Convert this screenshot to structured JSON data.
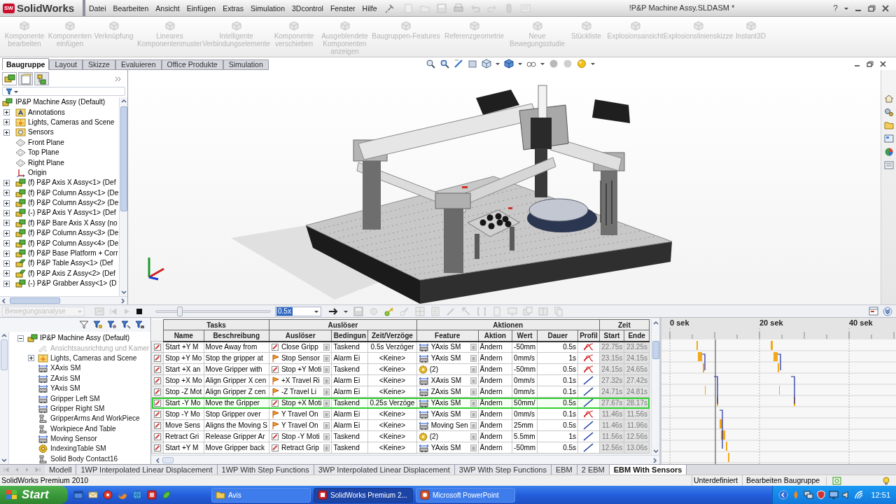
{
  "app_bar": {
    "logo_badge": "SW",
    "logo_name": "SolidWorks",
    "menus": [
      "Datei",
      "Bearbeiten",
      "Ansicht",
      "Einfügen",
      "Extras",
      "Simulation",
      "3Dcontrol",
      "Fenster",
      "Hilfe"
    ],
    "document_title": "!P&P Machine Assy.SLDASM *",
    "help": "?"
  },
  "command_manager": [
    {
      "label": "Komponente bearbeiten",
      "disabled": true
    },
    {
      "label": "Komponenten einfügen",
      "disabled": true
    },
    {
      "label": "Verknüpfung",
      "disabled": true
    },
    {
      "label": "Lineares Komponentenmuster",
      "disabled": true
    },
    {
      "label": "Intelligente Verbindungselemente",
      "disabled": true
    },
    {
      "label": "Komponente verschieben",
      "disabled": true
    },
    {
      "label": "Ausgeblendete Komponenten anzeigen",
      "disabled": true
    },
    {
      "label": "Baugruppen-Features",
      "disabled": true
    },
    {
      "label": "Referenzgeometrie",
      "disabled": true
    },
    {
      "label": "Neue Bewegungsstudie",
      "disabled": true
    },
    {
      "label": "Stückliste",
      "disabled": true
    },
    {
      "label": "Explosionsansicht",
      "disabled": true
    },
    {
      "label": "Explosionslinienskizze",
      "disabled": true
    },
    {
      "label": "Instant3D",
      "disabled": true
    }
  ],
  "command_tabs": [
    {
      "label": "Baugruppe",
      "selected": true
    },
    {
      "label": "Layout",
      "selected": false
    },
    {
      "label": "Skizze",
      "selected": false
    },
    {
      "label": "Evaluieren",
      "selected": false
    },
    {
      "label": "Office Produkte",
      "selected": false
    },
    {
      "label": "Simulation",
      "selected": false
    }
  ],
  "feature_tree": {
    "root": {
      "label": "IP&P Machine Assy  (Default)",
      "kind": "assembly",
      "children": [
        {
          "label": "Annotations",
          "kind": "annotations",
          "expanded": false
        },
        {
          "label": "Lights, Cameras and Scene",
          "kind": "lights",
          "expanded": false
        },
        {
          "label": "Sensors",
          "kind": "sensors",
          "expanded": false
        },
        {
          "label": "Front Plane",
          "kind": "plane"
        },
        {
          "label": "Top Plane",
          "kind": "plane"
        },
        {
          "label": "Right Plane",
          "kind": "plane"
        },
        {
          "label": "Origin",
          "kind": "origin"
        },
        {
          "label": "(f) P&P Axis X Assy<1> (Def",
          "kind": "assembly",
          "expanded": false
        },
        {
          "label": "(f) P&P Column Assy<1> (De",
          "kind": "assembly",
          "expanded": false
        },
        {
          "label": "(f) P&P Column Assy<2> (De",
          "kind": "assembly",
          "expanded": false
        },
        {
          "label": "(-) P&P Axis Y Assy<1> (Def",
          "kind": "assembly",
          "expanded": false
        },
        {
          "label": "(f) P&P Bare Axis X Assy (no",
          "kind": "assembly",
          "expanded": false
        },
        {
          "label": "(f) P&P Column Assy<3> (De",
          "kind": "assembly",
          "expanded": false
        },
        {
          "label": "(f) P&P Column Assy<4> (De",
          "kind": "assembly",
          "expanded": false
        },
        {
          "label": "(f) P&P Base Platform + Corr",
          "kind": "assembly",
          "expanded": false
        },
        {
          "label": "(f) P&P Table Assy<1> (Def",
          "kind": "flexible_assembly",
          "expanded": false
        },
        {
          "label": "(f) P&P Axis Z Assy<2> (Def",
          "kind": "flexible_assembly",
          "expanded": false
        },
        {
          "label": "(-) P&P Grabber Assy<1> (D",
          "kind": "assembly",
          "expanded": false
        }
      ]
    }
  },
  "motion_toolbar": {
    "study_type": {
      "label": "Bewegungsanalyse",
      "disabled": true
    },
    "time_slider": {
      "level": 0.2
    },
    "speed": "0.5x"
  },
  "motion_tree": {
    "root": {
      "label": "IP&P Machine Assy  (Default)",
      "kind": "assembly",
      "expanded": true,
      "children": [
        {
          "label": "Ansichtsausrichtung und Kamer",
          "kind": "view",
          "disabled": true
        },
        {
          "label": "Lights, Cameras and Scene",
          "kind": "lights",
          "expanded": false,
          "disabled": false
        },
        {
          "label": "XAxis SM",
          "kind": "motor",
          "disabled": false
        },
        {
          "label": "ZAxis SM",
          "kind": "motor",
          "disabled": false
        },
        {
          "label": "YAxis SM",
          "kind": "motor",
          "disabled": false
        },
        {
          "label": "Gripper Left SM",
          "kind": "motor",
          "disabled": false
        },
        {
          "label": "Gripper Right SM",
          "kind": "motor",
          "disabled": false
        },
        {
          "label": "GripperArms And WorkPiece",
          "kind": "contact",
          "disabled": false
        },
        {
          "label": "Workpiece And Table",
          "kind": "contact",
          "disabled": false
        },
        {
          "label": "Moving Sensor",
          "kind": "motor",
          "disabled": false
        },
        {
          "label": "IndexingTable SM",
          "kind": "rotary_motor",
          "disabled": false
        },
        {
          "label": "Solid Body Contact16",
          "kind": "contact",
          "disabled": false
        }
      ]
    }
  },
  "table": {
    "groups": [
      "Tasks",
      "Auslöser",
      "Aktionen",
      "Zeit"
    ],
    "columns": [
      "Name",
      "Beschreibung",
      "Auslöser",
      "Bedingun",
      "Zeit/Verzöge",
      "Feature",
      "Aktion",
      "Wert",
      "Dauer",
      "Profil",
      "Start",
      "Ende"
    ],
    "rows": [
      {
        "name": "Start +Y M",
        "description": "Move Away from",
        "trigger": {
          "label": "Close Gripp",
          "kind": "task"
        },
        "condition": "Taskend",
        "delay": "0.5s Verzöger",
        "feature": {
          "label": "YAxis SM",
          "kind": "motor"
        },
        "action": "Ändern",
        "value": "-50mm",
        "duration": "0.5s",
        "profile": {
          "kind": "curve"
        },
        "start": "22.75s",
        "end": "23.25s",
        "selected": false
      },
      {
        "name": "Stop +Y Mo",
        "description": "Stop the gripper at",
        "trigger": {
          "label": "Stop Sensor",
          "kind": "sensor"
        },
        "condition": "Alarm Ei",
        "delay": "<Keine>",
        "feature": {
          "label": "YAxis SM",
          "kind": "motor"
        },
        "action": "Ändern",
        "value": "0mm/s",
        "duration": "1s",
        "profile": {
          "kind": "curve"
        },
        "start": "23.15s",
        "end": "24.15s",
        "selected": false
      },
      {
        "name": "Start +X an",
        "description": "Move Gripper with",
        "trigger": {
          "label": "Stop +Y Moti",
          "kind": "task"
        },
        "condition": "Taskend",
        "delay": "<Keine>",
        "feature": {
          "label": "(2)",
          "kind": "group"
        },
        "action": "Ändern",
        "value": "-50mm",
        "duration": "0.5s",
        "profile": {
          "kind": "curve"
        },
        "start": "24.15s",
        "end": "24.65s",
        "selected": false
      },
      {
        "name": "Stop +X Mo",
        "description": "Align Gripper X cen",
        "trigger": {
          "label": "+X Travel Ri",
          "kind": "sensor"
        },
        "condition": "Alarm Ei",
        "delay": "<Keine>",
        "feature": {
          "label": "XAxis SM",
          "kind": "motor"
        },
        "action": "Ändern",
        "value": "0mm/s",
        "duration": "0.1s",
        "profile": {
          "kind": "linear"
        },
        "start": "27.32s",
        "end": "27.42s",
        "selected": false
      },
      {
        "name": "Stop -Z Mot",
        "description": "Align Gripper Z cen",
        "trigger": {
          "label": "-Z Travel Li",
          "kind": "sensor"
        },
        "condition": "Alarm Ei",
        "delay": "<Keine>",
        "feature": {
          "label": "ZAxis SM",
          "kind": "motor"
        },
        "action": "Ändern",
        "value": "0mm/s",
        "duration": "0.1s",
        "profile": {
          "kind": "linear"
        },
        "start": "24.71s",
        "end": "24.81s",
        "selected": false
      },
      {
        "name": "Start -Y Mo",
        "description": "Move the Gripper",
        "trigger": {
          "label": "Stop +X Moti",
          "kind": "task"
        },
        "condition": "Taskend",
        "delay": "0.25s Verzöge",
        "feature": {
          "label": "YAxis SM",
          "kind": "motor"
        },
        "action": "Ändern",
        "value": "50mm/",
        "duration": "0.5s",
        "profile": {
          "kind": "linear"
        },
        "start": "27.67s",
        "end": "28.17s",
        "selected": true
      },
      {
        "name": "Stop -Y Mo",
        "description": "Stop Gripper over",
        "trigger": {
          "label": "Y Travel On",
          "kind": "sensor"
        },
        "condition": "Alarm Ei",
        "delay": "<Keine>",
        "feature": {
          "label": "YAxis SM",
          "kind": "motor"
        },
        "action": "Ändern",
        "value": "0mm/s",
        "duration": "0.1s",
        "profile": {
          "kind": "curve"
        },
        "start": "11.46s",
        "end": "11.56s",
        "selected": false
      },
      {
        "name": "Move Sens",
        "description": "Aligns the Moving S",
        "trigger": {
          "label": "Y Travel On",
          "kind": "sensor"
        },
        "condition": "Alarm Ei",
        "delay": "<Keine>",
        "feature": {
          "label": "Moving Sen",
          "kind": "motor"
        },
        "action": "Ändern",
        "value": "25mm",
        "duration": "0.5s",
        "profile": {
          "kind": "linear"
        },
        "start": "11.46s",
        "end": "11.96s",
        "selected": false
      },
      {
        "name": "Retract Gri",
        "description": "Release Gripper Ar",
        "trigger": {
          "label": "Stop -Y Moti",
          "kind": "task"
        },
        "condition": "Taskend",
        "delay": "<Keine>",
        "feature": {
          "label": "(2)",
          "kind": "group"
        },
        "action": "Ändern",
        "value": "5.5mm",
        "duration": "1s",
        "profile": {
          "kind": "linear"
        },
        "start": "11.56s",
        "end": "12.56s",
        "selected": false
      },
      {
        "name": "Start +Y M",
        "description": "Move Gripper back",
        "trigger": {
          "label": "Retract Grip",
          "kind": "task"
        },
        "condition": "Taskend",
        "delay": "<Keine>",
        "feature": {
          "label": "YAxis SM",
          "kind": "motor"
        },
        "action": "Ändern",
        "value": "-50mm",
        "duration": "0.5s",
        "profile": {
          "kind": "linear"
        },
        "start": "12.56s",
        "end": "13.06s",
        "selected": false
      }
    ]
  },
  "timeline": {
    "ticks": [
      "0 sek",
      "20 sek",
      "40 sek"
    ]
  },
  "study_tabs": [
    {
      "label": "Modell",
      "selected": false
    },
    {
      "label": "1WP Interpolated Linear Displacement",
      "selected": false
    },
    {
      "label": "1WP With Step Functions",
      "selected": false
    },
    {
      "label": "3WP Interpolated Linear Displacement",
      "selected": false
    },
    {
      "label": "3WP With Step Functions",
      "selected": false
    },
    {
      "label": "EBM",
      "selected": false
    },
    {
      "label": "2 EBM",
      "selected": false
    },
    {
      "label": "EBM With Sensors",
      "selected": true
    }
  ],
  "status_bar": {
    "product": "SolidWorks Premium 2010",
    "state": "Unterdefiniert",
    "mode": "Bearbeiten Baugruppe"
  },
  "taskbar": {
    "start": "Start",
    "tasks": [
      {
        "label": "Avis",
        "kind": "folder",
        "selected": false
      },
      {
        "label": "SolidWorks Premium 2...",
        "kind": "cad",
        "selected": true
      },
      {
        "label": "Microsoft PowerPoint",
        "kind": "slides",
        "selected": false
      }
    ],
    "clock": "12:51"
  }
}
